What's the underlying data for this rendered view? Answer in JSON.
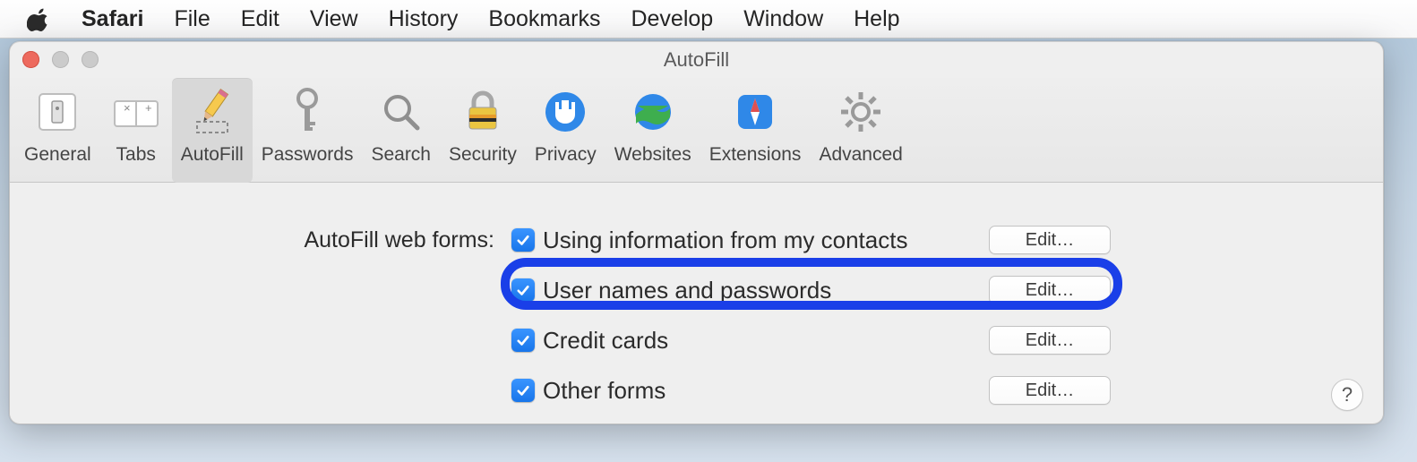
{
  "menubar": {
    "app_name": "Safari",
    "items": [
      "File",
      "Edit",
      "View",
      "History",
      "Bookmarks",
      "Develop",
      "Window",
      "Help"
    ]
  },
  "window": {
    "title": "AutoFill"
  },
  "toolbar": {
    "items": [
      {
        "id": "general",
        "label": "General",
        "selected": false
      },
      {
        "id": "tabs",
        "label": "Tabs",
        "selected": false
      },
      {
        "id": "autofill",
        "label": "AutoFill",
        "selected": true
      },
      {
        "id": "passwords",
        "label": "Passwords",
        "selected": false
      },
      {
        "id": "search",
        "label": "Search",
        "selected": false
      },
      {
        "id": "security",
        "label": "Security",
        "selected": false
      },
      {
        "id": "privacy",
        "label": "Privacy",
        "selected": false
      },
      {
        "id": "websites",
        "label": "Websites",
        "selected": false
      },
      {
        "id": "extensions",
        "label": "Extensions",
        "selected": false
      },
      {
        "id": "advanced",
        "label": "Advanced",
        "selected": false
      }
    ]
  },
  "content": {
    "section_label": "AutoFill web forms:",
    "edit_button_label": "Edit…",
    "options": [
      {
        "id": "contacts",
        "label": "Using information from my contacts",
        "checked": true
      },
      {
        "id": "passwords",
        "label": "User names and passwords",
        "checked": true,
        "highlighted": true
      },
      {
        "id": "creditcards",
        "label": "Credit cards",
        "checked": true
      },
      {
        "id": "otherforms",
        "label": "Other forms",
        "checked": true
      }
    ],
    "help_label": "?"
  }
}
